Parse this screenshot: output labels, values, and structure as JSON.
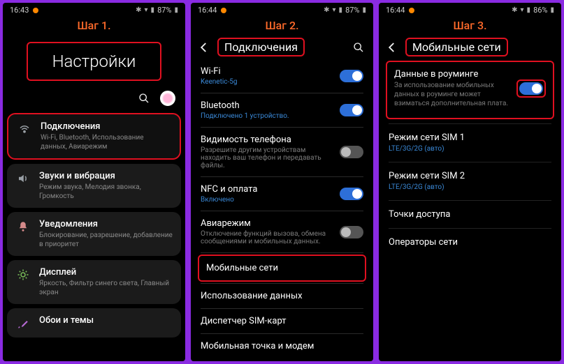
{
  "status": {
    "time1": "16:43",
    "time2": "16:44",
    "time3": "16:44",
    "battery1": "87%",
    "battery2": "87%",
    "battery3": "86%"
  },
  "steps": {
    "s1": "Шаг 1.",
    "s2": "Шаг 2.",
    "s3": "Шаг 3."
  },
  "panel1": {
    "title": "Настройки",
    "items": [
      {
        "icon": "wifi",
        "title": "Подключения",
        "sub": "Wi-Fi, Bluetooth, Использование данных, Авиарежим"
      },
      {
        "icon": "sound",
        "title": "Звуки и вибрация",
        "sub": "Режим звука, Мелодия звонка, Громкость"
      },
      {
        "icon": "bell",
        "title": "Уведомления",
        "sub": "Блокирование, разрешение, добавление в приоритет"
      },
      {
        "icon": "sun",
        "title": "Дисплей",
        "sub": "Яркость, Фильтр синего света, Главный экран"
      },
      {
        "icon": "brush",
        "title": "Обои и темы",
        "sub": ""
      }
    ]
  },
  "panel2": {
    "title": "Подключения",
    "rows": [
      {
        "title": "Wi-Fi",
        "sub": "Keenetic-5g",
        "subClass": "blue",
        "toggle": "on"
      },
      {
        "title": "Bluetooth",
        "sub": "Подключено 1 устройство.",
        "subClass": "blue",
        "toggle": "on"
      },
      {
        "title": "Видимость телефона",
        "sub": "Разрешите другим устройствам находить ваш телефон и передавать файлы.",
        "subClass": "gray",
        "toggle": "off"
      },
      {
        "title": "NFC и оплата",
        "sub": "Включено",
        "subClass": "blue",
        "toggle": "on"
      },
      {
        "title": "Авиарежим",
        "sub": "Отключение функций вызова, обмена сообщениями и мобильных данных.",
        "subClass": "gray",
        "toggle": "off"
      }
    ],
    "simple": [
      "Мобильные сети",
      "Использование данных",
      "Диспетчер SIM-карт",
      "Мобильная точка и модем"
    ]
  },
  "panel3": {
    "title": "Мобильные сети",
    "roaming": {
      "title": "Данные в роуминге",
      "sub": "За использование мобильных данных в роуминге может взиматься дополнительная плата.",
      "toggle": "on"
    },
    "rows": [
      {
        "title": "Режим сети SIM 1",
        "sub": "LTE/3G/2G (авто)"
      },
      {
        "title": "Режим сети SIM 2",
        "sub": "LTE/3G/2G (авто)"
      },
      {
        "title": "Точки доступа",
        "sub": ""
      },
      {
        "title": "Операторы сети",
        "sub": ""
      }
    ]
  }
}
